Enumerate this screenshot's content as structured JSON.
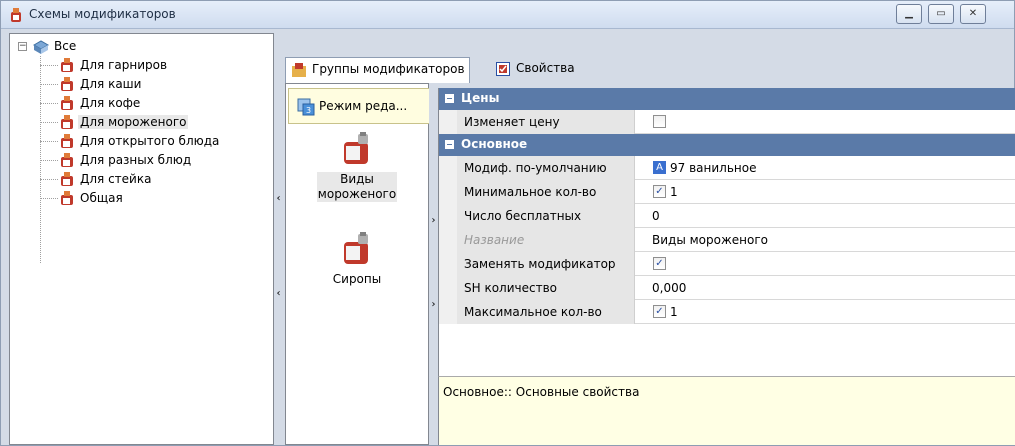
{
  "window": {
    "title": "Схемы модификаторов",
    "buttons": [
      "minimize",
      "maximize",
      "close"
    ]
  },
  "tree": {
    "root": "Все",
    "items": [
      {
        "label": "Для гарниров"
      },
      {
        "label": "Для каши"
      },
      {
        "label": "Для кофе"
      },
      {
        "label": "Для мороженого",
        "selected": true
      },
      {
        "label": "Для открытого блюда"
      },
      {
        "label": "Для разных блюд"
      },
      {
        "label": "Для стейка"
      },
      {
        "label": "Общая"
      }
    ]
  },
  "tabs": [
    {
      "label": "Группы модификаторов",
      "active": true,
      "icon": "groups-icon"
    },
    {
      "label": "Свойства",
      "active": false,
      "icon": "properties-icon"
    }
  ],
  "groups_panel": {
    "mode_button": "Режим реда...",
    "groups": [
      {
        "label": "Виды мороженого",
        "selected": true
      },
      {
        "label": "Сиропы",
        "selected": false
      }
    ]
  },
  "properties": {
    "categories": [
      {
        "label": "Цены",
        "rows": [
          {
            "name": "Изменяет цену",
            "type": "checkbox",
            "checked": false,
            "value": ""
          }
        ]
      },
      {
        "label": "Основное",
        "rows": [
          {
            "name": "Модиф. по-умолчанию",
            "type": "lookup",
            "value": "97 ванильное"
          },
          {
            "name": "Минимальное кол-во",
            "type": "checkbox",
            "checked": true,
            "value": "1"
          },
          {
            "name": "Число бесплатных",
            "type": "text",
            "value": "0"
          },
          {
            "name": "Название",
            "type": "text",
            "value": "Виды мороженого",
            "disabled": true
          },
          {
            "name": "Заменять модификатор",
            "type": "checkbox",
            "checked": true,
            "value": ""
          },
          {
            "name": "SH количество",
            "type": "text",
            "value": "0,000"
          },
          {
            "name": "Максимальное кол-во",
            "type": "checkbox",
            "checked": true,
            "value": "1"
          }
        ]
      }
    ]
  },
  "description": "Основное:: Основные свойства",
  "colors": {
    "category_header": "#5a7aa8",
    "description_bg": "#ffffe4",
    "mode_button_bg": "#fffde0"
  }
}
